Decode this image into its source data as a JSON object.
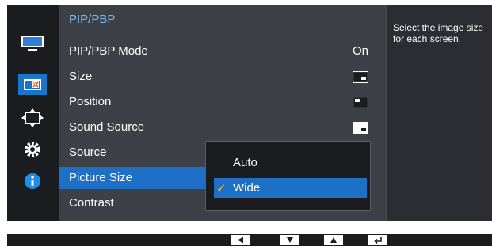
{
  "menu": {
    "title": "PIP/PBP",
    "items": [
      {
        "label": "PIP/PBP Mode",
        "value": "On"
      },
      {
        "label": "Size",
        "value": ""
      },
      {
        "label": "Position",
        "value": ""
      },
      {
        "label": "Sound Source",
        "value": ""
      },
      {
        "label": "Source",
        "value": ""
      },
      {
        "label": "Picture Size",
        "value": ""
      },
      {
        "label": "Contrast",
        "value": ""
      }
    ],
    "selected_index": 5
  },
  "dropdown": {
    "options": [
      {
        "label": "Auto",
        "checked": false
      },
      {
        "label": "Wide",
        "checked": true
      }
    ],
    "check_glyph": "✓"
  },
  "help": {
    "text": "Select the image size for each screen."
  },
  "sidebar_icons": [
    "monitor-icon",
    "picture-in-picture-icon",
    "resize-arrows-icon",
    "settings-gear-icon",
    "info-icon"
  ],
  "bottom_nav": [
    "left-arrow-key-icon",
    "down-arrow-key-icon",
    "up-arrow-key-icon",
    "enter-key-icon"
  ],
  "colors": {
    "accent": "#1d70c5",
    "title_color": "#78b7ec",
    "check_color": "#f5c518"
  }
}
